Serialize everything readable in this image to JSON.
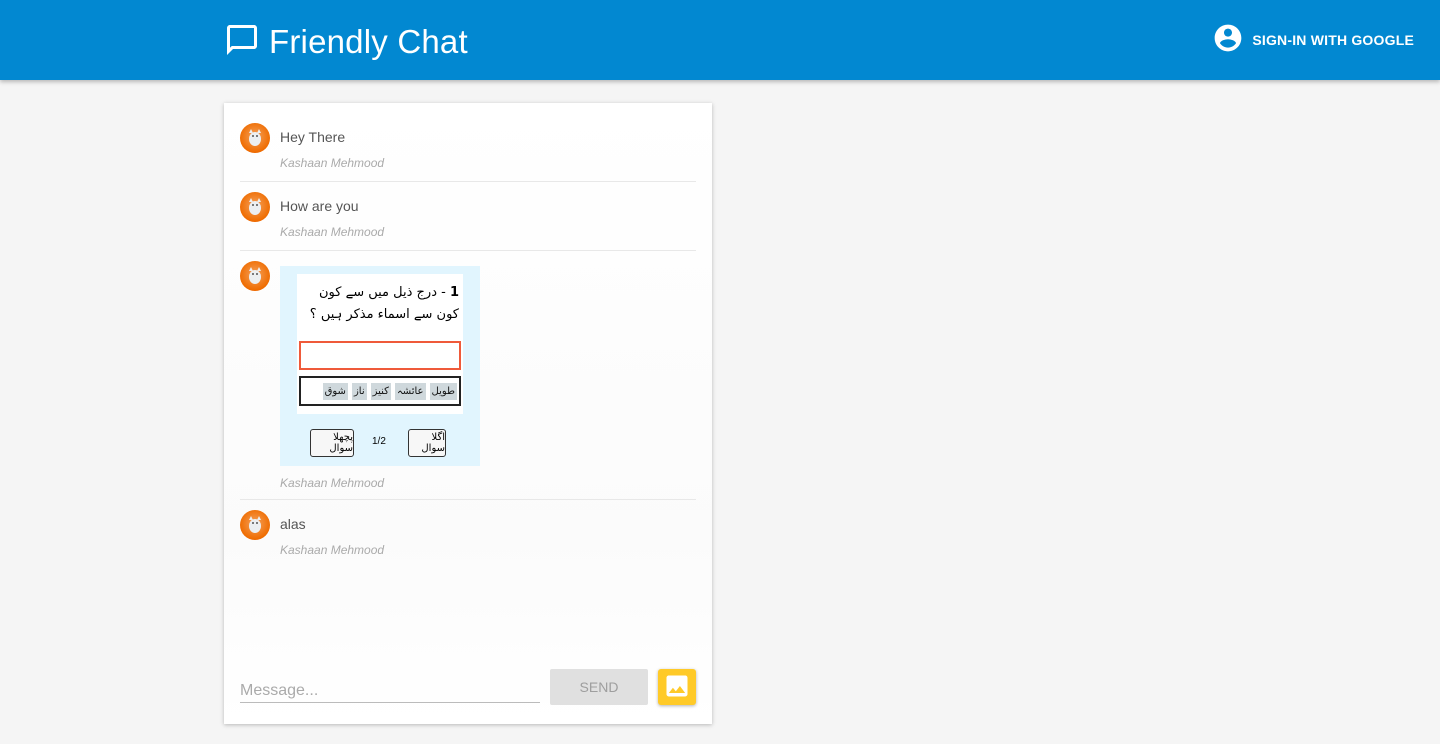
{
  "header": {
    "title": "Friendly Chat",
    "signin_label": "SIGN-IN WITH GOOGLE",
    "brand_color": "#0288d1"
  },
  "messages": [
    {
      "text": "Hey There",
      "author": "Kashaan Mehmood"
    },
    {
      "text": "How are you",
      "author": "Kashaan Mehmood"
    },
    {
      "author": "Kashaan Mehmood",
      "image": {
        "question_number": "1",
        "question_text": "- درج ذیل میں سے کون کون سے اسماء مذکر ہیں ؟",
        "choices": [
          "طویل",
          "عائشہ",
          "کنیز",
          "ناز",
          "شوق"
        ],
        "prev_label": "پچھلا سوال",
        "next_label": "اگلا سوال",
        "page": "1/2"
      }
    },
    {
      "text": "alas",
      "author": "Kashaan Mehmood"
    }
  ],
  "composer": {
    "placeholder": "Message...",
    "send_label": "SEND",
    "image_icon": "image-icon"
  }
}
